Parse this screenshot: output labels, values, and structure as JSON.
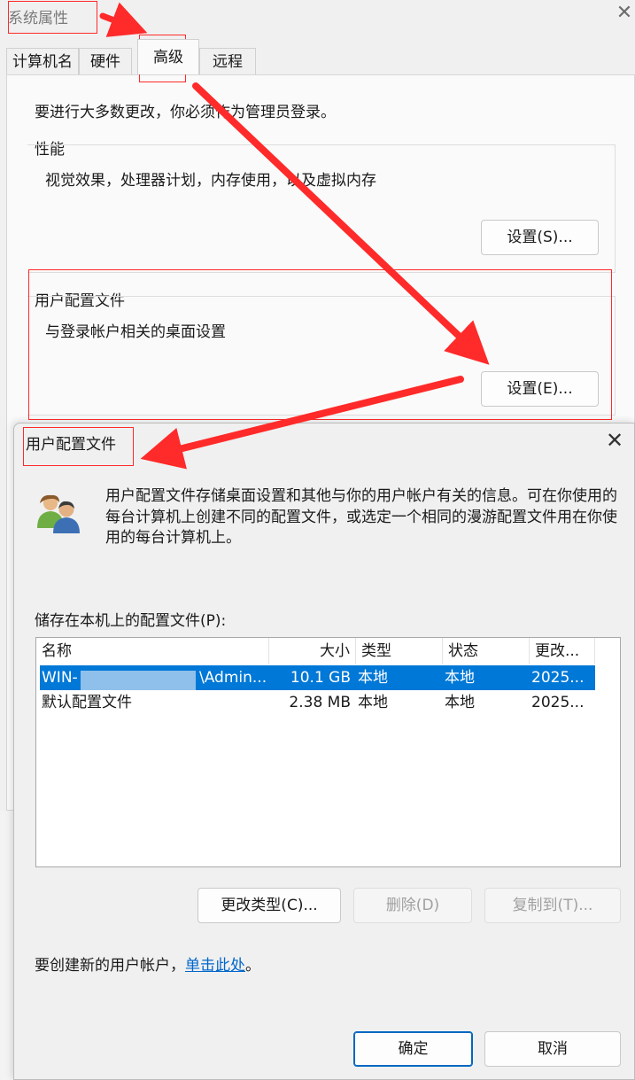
{
  "system_properties": {
    "title": "系统属性",
    "tabs": [
      {
        "label": "计算机名"
      },
      {
        "label": "硬件"
      },
      {
        "label": "高级"
      },
      {
        "label": "远程"
      }
    ],
    "admin_note": "要进行大多数更改，你必须作为管理员登录。",
    "performance": {
      "title": "性能",
      "description": "视觉效果，处理器计划，内存使用，以及虚拟内存",
      "settings_label": "设置(S)..."
    },
    "user_profiles": {
      "title": "用户配置文件",
      "description": "与登录帐户相关的桌面设置",
      "settings_label": "设置(E)..."
    }
  },
  "profiles_dialog": {
    "title": "用户配置文件",
    "info_text": "用户配置文件存储桌面设置和其他与你的用户帐户有关的信息。可在你使用的每台计算机上创建不同的配置文件，或选定一个相同的漫游配置文件用在你使用的每台计算机上。",
    "list_label": "储存在本机上的配置文件(P):",
    "columns": [
      "名称",
      "大小",
      "类型",
      "状态",
      "更改..."
    ],
    "rows": [
      {
        "name": "WIN-",
        "name_suffix": "\\Admin...",
        "size": "10.1 GB",
        "type": "本地",
        "status": "本地",
        "modified": "2025...",
        "selected": true
      },
      {
        "name": "默认配置文件",
        "size": "2.38 MB",
        "type": "本地",
        "status": "本地",
        "modified": "2025...",
        "selected": false
      }
    ],
    "buttons": {
      "change_type": "更改类型(C)...",
      "delete": "删除(D)",
      "copy_to": "复制到(T)..."
    },
    "create_prefix": "要创建新的用户帐户，",
    "create_link": "单击此处",
    "create_suffix": "。",
    "ok": "确定",
    "cancel": "取消"
  },
  "colors": {
    "annotation_red": "#ff2a2a",
    "selection_blue": "#0078d7",
    "link_blue": "#0066cc"
  }
}
